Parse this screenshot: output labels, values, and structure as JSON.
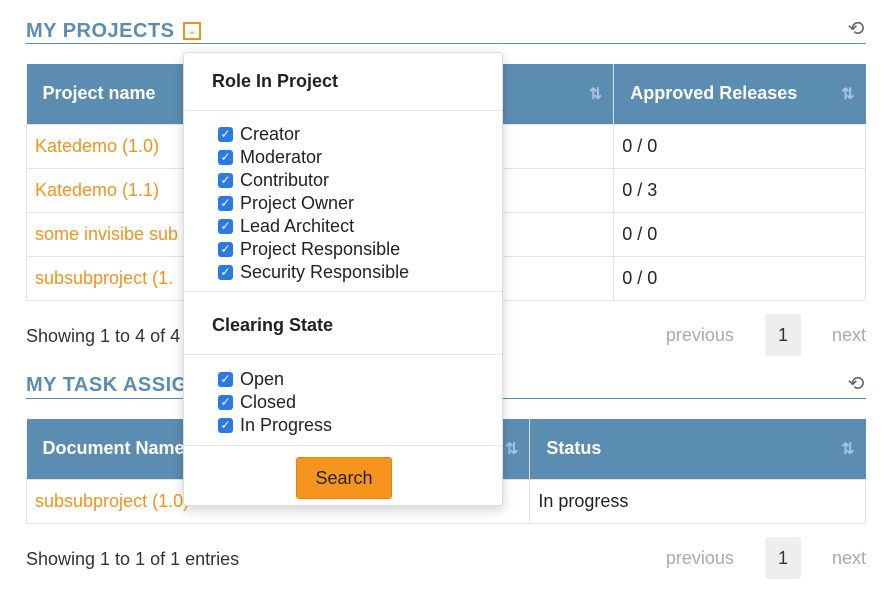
{
  "projects": {
    "title": "MY PROJECTS",
    "filter_icon": "chevron-down",
    "refresh_icon": "refresh",
    "columns": [
      "Project name",
      "Approved Releases"
    ],
    "rows": [
      {
        "name": "Katedemo (1.0)",
        "approved": "0 / 0"
      },
      {
        "name": "Katedemo (1.1)",
        "approved": "0 / 3"
      },
      {
        "name": "some invisibe sub",
        "approved": "0 / 0"
      },
      {
        "name": "subsubproject (1.",
        "approved": "0 / 0"
      }
    ],
    "info": "Showing 1 to 4 of 4",
    "pager": {
      "previous": "previous",
      "page": "1",
      "next": "next"
    }
  },
  "tasks": {
    "title": "MY TASK ASSIG",
    "refresh_icon": "refresh",
    "columns": [
      "Document Name",
      "Status"
    ],
    "rows": [
      {
        "name": "subsubproject (1.0)",
        "status": "In progress"
      }
    ],
    "info": "Showing 1 to 1 of 1 entries",
    "pager": {
      "previous": "previous",
      "page": "1",
      "next": "next"
    }
  },
  "filter_dropdown": {
    "role_heading": "Role In Project",
    "roles": [
      "Creator",
      "Moderator",
      "Contributor",
      "Project Owner",
      "Lead Architect",
      "Project Responsible",
      "Security Responsible"
    ],
    "clearing_heading": "Clearing State",
    "states": [
      "Open",
      "Closed",
      "In Progress"
    ],
    "search_label": "Search"
  },
  "colors": {
    "accent": "#5b8db3",
    "link": "#f0931e",
    "button": "#f7941d",
    "checkbox": "#2a7ae2"
  }
}
